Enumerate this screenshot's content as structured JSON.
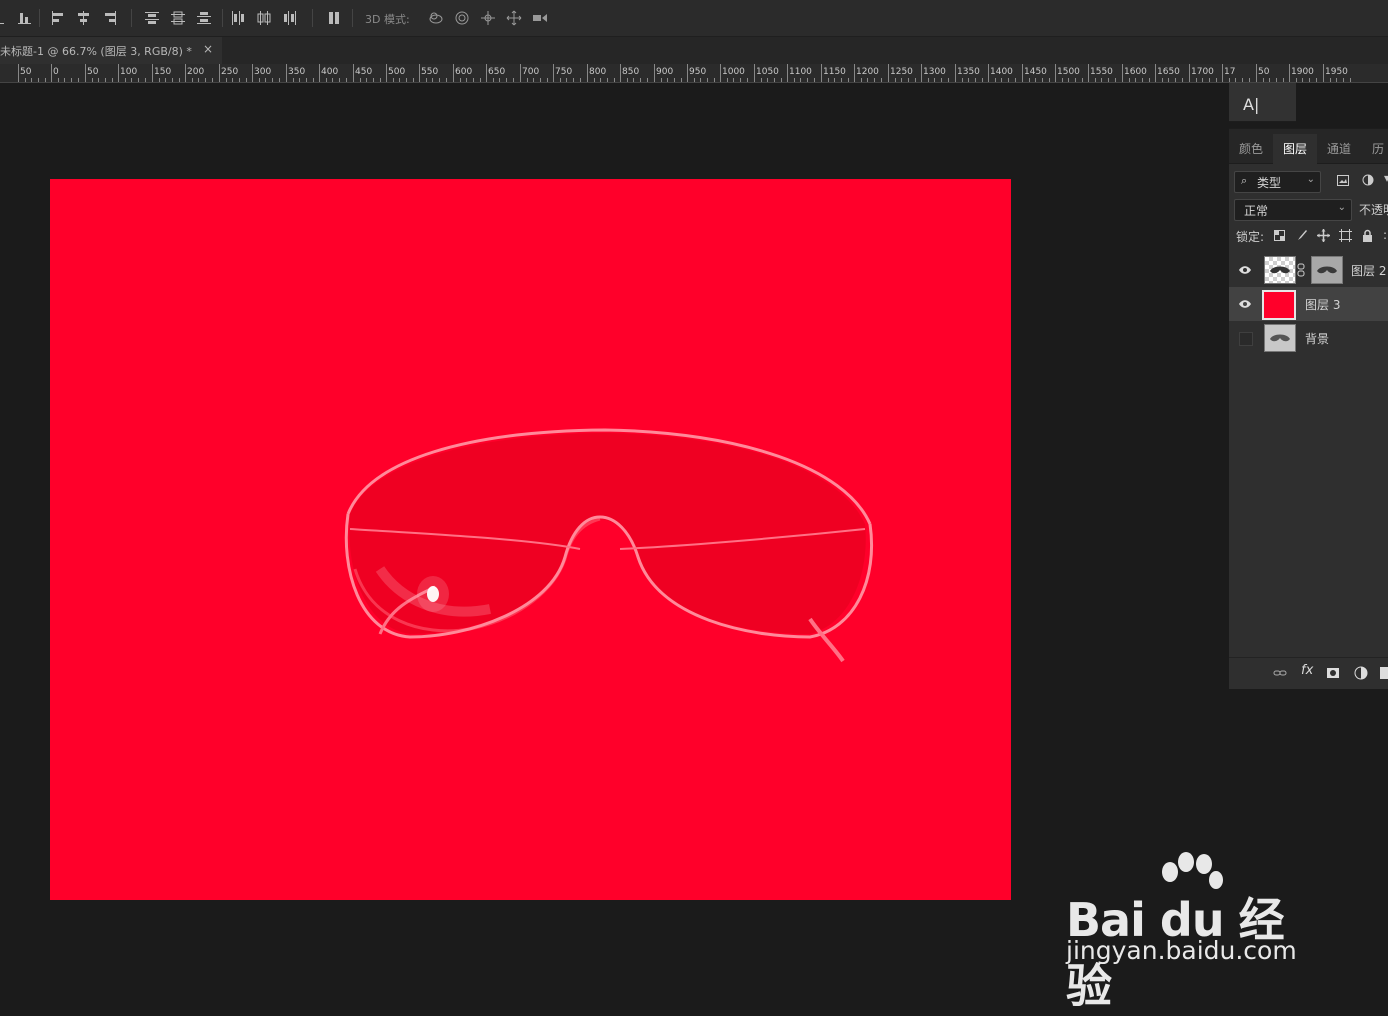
{
  "options_bar": {
    "mode_label": "3D 模式:",
    "icons": [
      "align-bottom-icon",
      "align-left-icon",
      "align-hcenter-icon",
      "align-right-icon",
      "distribute-top-icon",
      "distribute-vcenter-icon",
      "distribute-bottom-icon",
      "distribute-left-icon",
      "distribute-hcenter-icon",
      "distribute-right-icon",
      "auto-align-icon",
      "orbit-3d-icon",
      "roll-3d-icon",
      "drag-3d-icon",
      "slide-3d-icon",
      "scale-3d-icon"
    ]
  },
  "document_tab": {
    "title": "未标题-1 @ 66.7% (图层 3, RGB/8) *",
    "close": "×"
  },
  "ruler": {
    "labels": [
      "50",
      "0",
      "50",
      "100",
      "150",
      "200",
      "250",
      "300",
      "350",
      "400",
      "450",
      "500",
      "550",
      "600",
      "650",
      "700",
      "750",
      "800",
      "850",
      "900",
      "950",
      "1000",
      "1050",
      "1100",
      "1150",
      "1200",
      "1250",
      "1300",
      "1350",
      "1400",
      "1450",
      "1500",
      "1550",
      "1600",
      "1650",
      "1700",
      "17",
      "50",
      "1900",
      "1950"
    ]
  },
  "document": {
    "background_color": "#ff002a"
  },
  "character_panel": {
    "icon": "A|"
  },
  "layers_panel": {
    "tabs": [
      {
        "label": "颜色",
        "active": false
      },
      {
        "label": "图层",
        "active": true
      },
      {
        "label": "通道",
        "active": false
      },
      {
        "label": "历",
        "active": false
      }
    ],
    "filter": {
      "label": "类型",
      "icon": "search-icon"
    },
    "blend_mode": "正常",
    "opacity_label": "不透明",
    "lock_label": "锁定:",
    "layers": [
      {
        "name": "图层 2",
        "visible": true,
        "selected": false,
        "has_mask": true
      },
      {
        "name": "图层 3",
        "visible": true,
        "selected": true,
        "has_mask": false
      },
      {
        "name": "背景",
        "visible": false,
        "selected": false,
        "has_mask": false
      }
    ],
    "footer_icons": [
      "link-layers-icon",
      "fx-icon",
      "add-mask-icon",
      "adjustment-layer-icon",
      "new-layer-icon"
    ]
  },
  "watermark": {
    "logo_text": "Bai du 经验",
    "url": "jingyan.baidu.com"
  },
  "colors": {
    "canvas_bg": "#1b1b1b",
    "panel_bg": "#2f2f2f",
    "document_red": "#ff002a"
  }
}
